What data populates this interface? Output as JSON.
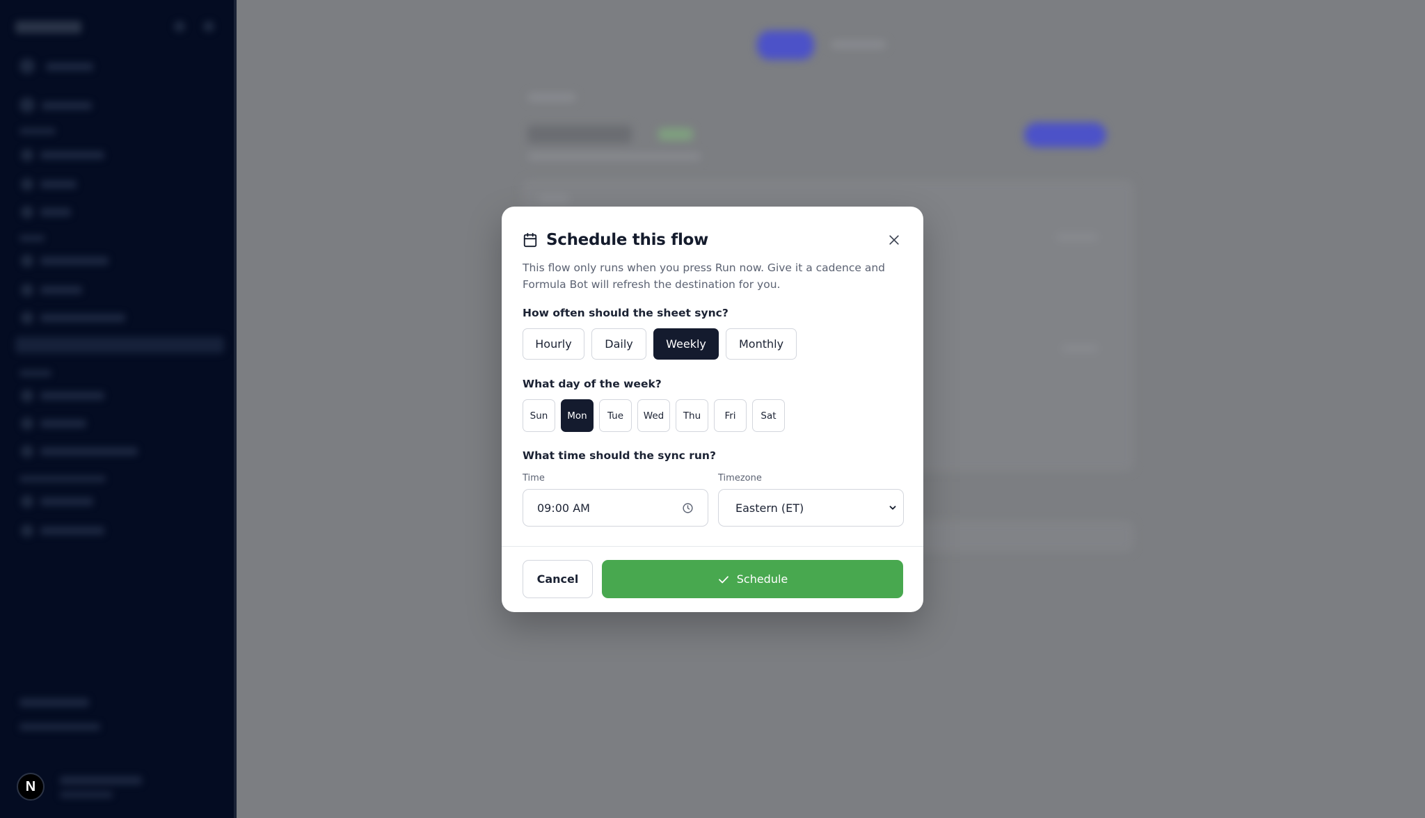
{
  "modal": {
    "title": "Schedule this flow",
    "title_icon": "calendar-icon",
    "close_icon": "close-icon",
    "description": "This flow only runs when you press Run now. Give it a cadence and Formula Bot will refresh the destination for you.",
    "frequency": {
      "question": "How often should the sheet sync?",
      "options": [
        "Hourly",
        "Daily",
        "Weekly",
        "Monthly"
      ],
      "selected": "Weekly"
    },
    "day": {
      "question": "What day of the week?",
      "options": [
        "Sun",
        "Mon",
        "Tue",
        "Wed",
        "Thu",
        "Fri",
        "Sat"
      ],
      "selected": "Mon"
    },
    "time": {
      "question": "What time should the sync run?",
      "time_label": "Time",
      "time_value": "09:00 AM",
      "time_icon": "clock-icon",
      "timezone_label": "Timezone",
      "timezone_value": "Eastern (ET)",
      "timezone_icon": "chevron-down-icon"
    },
    "actions": {
      "cancel": "Cancel",
      "schedule": "Schedule",
      "schedule_icon": "check-icon"
    }
  },
  "sidebar": {
    "avatar_letter": "N"
  },
  "colors": {
    "primary_dark": "#141b2e",
    "schedule_green": "#48a84f",
    "sidebar_bg": "#040c22",
    "overlay": "#7c7e82"
  }
}
